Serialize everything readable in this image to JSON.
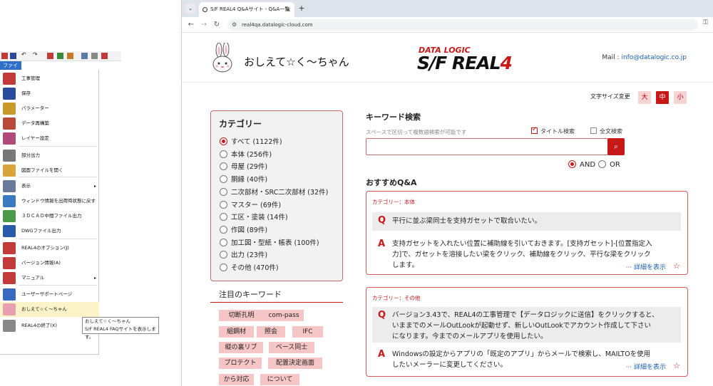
{
  "app": {
    "file_tab": "ファイル",
    "menu_items": [
      {
        "label": "工事管理",
        "icon": "building-icon",
        "color": "#c23b3b"
      },
      {
        "label": "保存",
        "icon": "floppy-icon",
        "color": "#2a4a9a"
      },
      {
        "label": "パラメーター",
        "icon": "parameter-icon",
        "color": "#c89a2a"
      },
      {
        "label": "データ再構築",
        "icon": "rebuild-icon",
        "color": "#b84a3a"
      },
      {
        "label": "レイヤー設定",
        "icon": "layer-icon",
        "color": "#b04a7a"
      },
      {
        "label": "部分出力",
        "icon": "printer-icon",
        "color": "#777777"
      },
      {
        "label": "図面ファイルを開く",
        "icon": "folder-icon",
        "color": "#d9a53a"
      },
      {
        "label": "表示",
        "icon": "view-icon",
        "color": "#6a7a9a",
        "arrow": "▸"
      },
      {
        "label": "ウィンドウ情報を出荷時状態に戻す",
        "icon": "window-icon",
        "color": "#3a7abf"
      },
      {
        "label": "３ＤＣＡＤ中間ファイル出力",
        "icon": "cad-icon",
        "color": "#4a9a4a"
      },
      {
        "label": "DWGファイル出力",
        "icon": "dwg-icon",
        "color": "#2a5aaa"
      },
      {
        "label": "REAL4のオプション(J)",
        "icon": "options-icon",
        "color": "#c23b3b"
      },
      {
        "label": "バージョン情報(A)",
        "icon": "version-icon",
        "color": "#c23b3b"
      },
      {
        "label": "マニュアル",
        "icon": "manual-icon",
        "color": "#c23b3b",
        "arrow": "▸"
      },
      {
        "label": "ユーザーサポートページ",
        "icon": "support-icon",
        "color": "#3a6abf"
      },
      {
        "label": "おしえて☆く〜ちゃん",
        "icon": "bunny-icon",
        "color": "#e8a0b0"
      },
      {
        "label": "REAL4の終了(X)",
        "icon": "exit-icon",
        "color": "#888888"
      }
    ],
    "tooltip_title": "おしえて☆く〜ちゃん",
    "tooltip_desc": "S/F REAL4 FAQサイトを表示します。"
  },
  "browser": {
    "tab_title": "S/F REAL4 Q&Aサイト - Q&A一覧",
    "url": "real4qa.datalogic-cloud.com",
    "new_tab": "+",
    "tab_close": "×"
  },
  "site": {
    "title": "おしえて☆く〜ちゃん",
    "logo_top": "DATA LOGIC",
    "logo_main": "S/F REAL",
    "logo_four": "4",
    "mail_label": "Mail : ",
    "mail_address": "info@datalogic.co.jp",
    "font_size_label": "文字サイズ変更",
    "font_sizes": [
      "大",
      "中",
      "小"
    ],
    "font_size_selected": "中",
    "category_title": "カテゴリー",
    "categories": [
      "すべて (1122件)",
      "本体 (256件)",
      "母屋 (29件)",
      "胴縁 (40件)",
      "二次部材・SRC二次部材 (32件)",
      "マスター (69件)",
      "工区・塗装 (14件)",
      "作図 (89件)",
      "加工図・型紙・帳表 (100件)",
      "出力 (23件)",
      "その他 (470件)"
    ],
    "selected_category": "すべて (1122件)",
    "keyword_title": "注目のキーワード",
    "keywords": [
      "切断孔明",
      "com-pass",
      "組鋼材",
      "照会",
      "IFC",
      "縦の裏リブ",
      "ベース同士",
      "プロテクト",
      "配置決定画面",
      "から対応",
      "について"
    ],
    "search_title": "キーワード検索",
    "search_hint": "スペースで区切って複数語検索が可能です",
    "title_search": "タイトル検索",
    "title_search_checked": true,
    "fulltext_search": "全文検索",
    "fulltext_search_checked": false,
    "search_placeholder": "",
    "logic_and": "AND",
    "logic_or": "OR",
    "logic_selected": "AND",
    "recommend_title": "おすすめQ&A",
    "qa": [
      {
        "category": "カテゴリー：本体",
        "q_mark": "Q",
        "question": "平行に並ぶ梁同士を支持ガセットで取合いたい。",
        "a_mark": "A",
        "answer_lines": [
          "支持ガセットを入れたい位置に補助線を引いておきます。[支持ガセット]-[位置指定入",
          "力]で、ガセットを溶接したい梁をクリック、補助線をクリック、平行な梁をクリック",
          "します。"
        ],
        "more": "··· 詳細を表示",
        "star": "☆"
      },
      {
        "category": "カテゴリー：その他",
        "q_mark": "Q",
        "question_lines": [
          "バージョン3.43で、REAL4の工事管理で【データロジックに送信】をクリックすると、",
          "いままでのメールOutLookが起動せず、新しいOutLookでアカウント作成して下さい",
          "になります。今までのメールアプリを使用したい。"
        ],
        "a_mark": "A",
        "answer_lines": [
          "Windowsの設定からアプリの「既定のアプリ」からメールで検索し、MAILTOを使用",
          "したいメーラーに変更してください。"
        ],
        "more": "··· 詳細を表示",
        "star": "☆"
      }
    ]
  },
  "colors": {
    "accent": "#c81818",
    "link": "#1a5fb4",
    "keyword_bg": "#f6c6c6"
  }
}
